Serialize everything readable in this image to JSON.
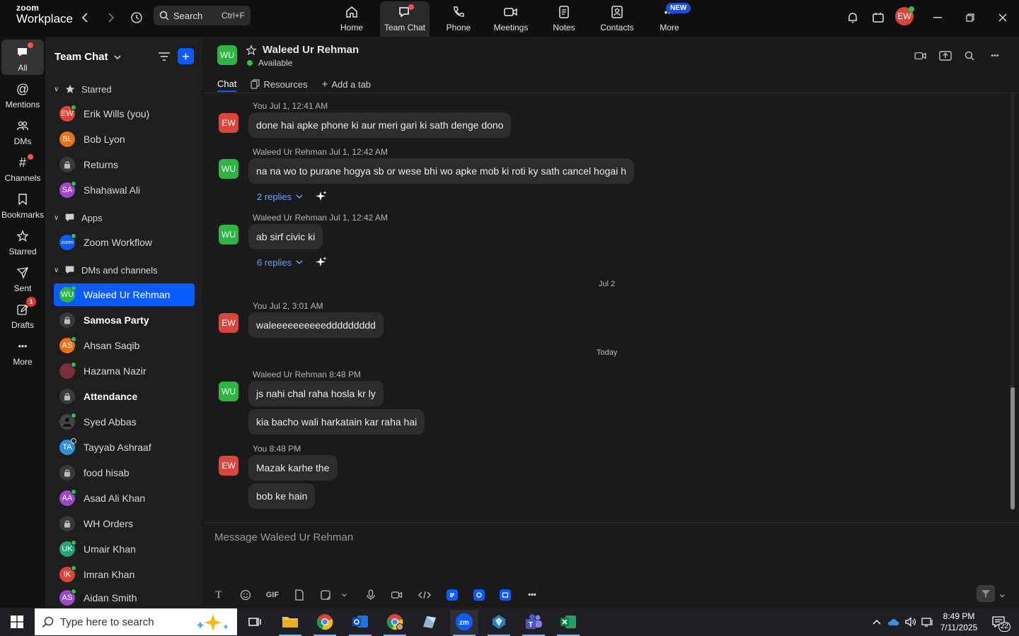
{
  "app": {
    "logo_top": "zoom",
    "logo_bottom": "Workplace"
  },
  "topbar": {
    "search_label": "Search",
    "search_shortcut": "Ctrl+F",
    "nav": [
      {
        "label": "Home"
      },
      {
        "label": "Team Chat"
      },
      {
        "label": "Phone"
      },
      {
        "label": "Meetings"
      },
      {
        "label": "Notes"
      },
      {
        "label": "Contacts"
      },
      {
        "label": "More"
      }
    ],
    "new_badge": "NEW",
    "user_initials": "EW"
  },
  "rail": [
    {
      "label": "All"
    },
    {
      "label": "Mentions"
    },
    {
      "label": "DMs"
    },
    {
      "label": "Channels"
    },
    {
      "label": "Bookmarks"
    },
    {
      "label": "Starred"
    },
    {
      "label": "Sent"
    },
    {
      "label": "Drafts",
      "badge": "1"
    },
    {
      "label": "More"
    }
  ],
  "sidebar": {
    "title": "Team Chat",
    "sections": [
      {
        "label": "Starred"
      },
      {
        "label": "Apps"
      },
      {
        "label": "DMs and channels"
      }
    ],
    "items": [
      {
        "label": "Erik Wills (you)",
        "initials": "EW",
        "color": "#d9453b"
      },
      {
        "label": "Bob Lyon",
        "initials": "BL",
        "color": "#e8711a"
      },
      {
        "label": "Returns"
      },
      {
        "label": "Shahawal Ali",
        "initials": "SA",
        "color": "#9c47c9"
      },
      {
        "label": "Zoom Workflow",
        "initials": "zoom",
        "color": "#0b5cff"
      },
      {
        "label": "Waleed Ur Rehman",
        "initials": "WU",
        "color": "#2fb344"
      },
      {
        "label": "Samosa Party"
      },
      {
        "label": "Ahsan Saqib",
        "initials": "AS",
        "color": "#e8711a"
      },
      {
        "label": "Hazama Nazir",
        "initials": "",
        "color": "#7a2e3c"
      },
      {
        "label": "Attendance"
      },
      {
        "label": "Syed Abbas",
        "initials": "",
        "color": "#444444"
      },
      {
        "label": "Tayyab Ashraaf",
        "initials": "TA",
        "color": "#2f8fd6"
      },
      {
        "label": "food hisab"
      },
      {
        "label": "Asad Ali Khan",
        "initials": "AA",
        "color": "#9c47c9"
      },
      {
        "label": "WH Orders"
      },
      {
        "label": "Umair Khan",
        "initials": "UK",
        "color": "#22a37a"
      },
      {
        "label": "Imran Khan",
        "initials": "IK",
        "color": "#d9453b"
      },
      {
        "label": "Aidan Smith",
        "initials": "AS",
        "color": "#9c47c9"
      }
    ]
  },
  "chat": {
    "contact_initials": "WU",
    "contact_name": "Waleed Ur Rehman",
    "status": "Available",
    "tabs": [
      "Chat",
      "Resources",
      "Add a tab"
    ],
    "messages": [
      {
        "initials": "EW",
        "meta": "You Jul 1, 12:41 AM",
        "text": "done hai apke phone ki aur meri gari ki sath denge dono"
      },
      {
        "initials": "WU",
        "meta": "Waleed Ur Rehman Jul 1, 12:42 AM",
        "text": "na na wo to purane hogya sb or wese bhi wo apke mob ki roti ky sath cancel hogai h",
        "replies": "2 replies"
      },
      {
        "initials": "WU",
        "meta": "Waleed Ur Rehman Jul 1, 12:42 AM",
        "text": "ab sirf civic ki",
        "replies": "6 replies"
      },
      {
        "initials": "EW",
        "meta": "You Jul 2, 3:01 AM",
        "text": "waleeeeeeeeeeddddddddd"
      },
      {
        "initials": "WU",
        "meta": "Waleed Ur Rehman 8:48 PM",
        "text": "js nahi chal raha hosla kr ly",
        "text2": "kia bacho wali harkatain kar raha hai"
      },
      {
        "initials": "EW",
        "meta": "You 8:48 PM",
        "text": "Mazak karhe the",
        "text2": "bob ke hain"
      }
    ],
    "date_separators": [
      "Jul 2",
      "Today"
    ],
    "composer_placeholder": "Message Waleed Ur Rehman",
    "gif_label": "GIF"
  },
  "taskbar": {
    "search_placeholder": "Type here to search",
    "time": "8:49 PM",
    "date": "7/11/2025",
    "notif_count": "22"
  },
  "colors": {
    "accent": "#0b5cff",
    "user_red": "#d9453b",
    "contact_green": "#2fb344"
  }
}
